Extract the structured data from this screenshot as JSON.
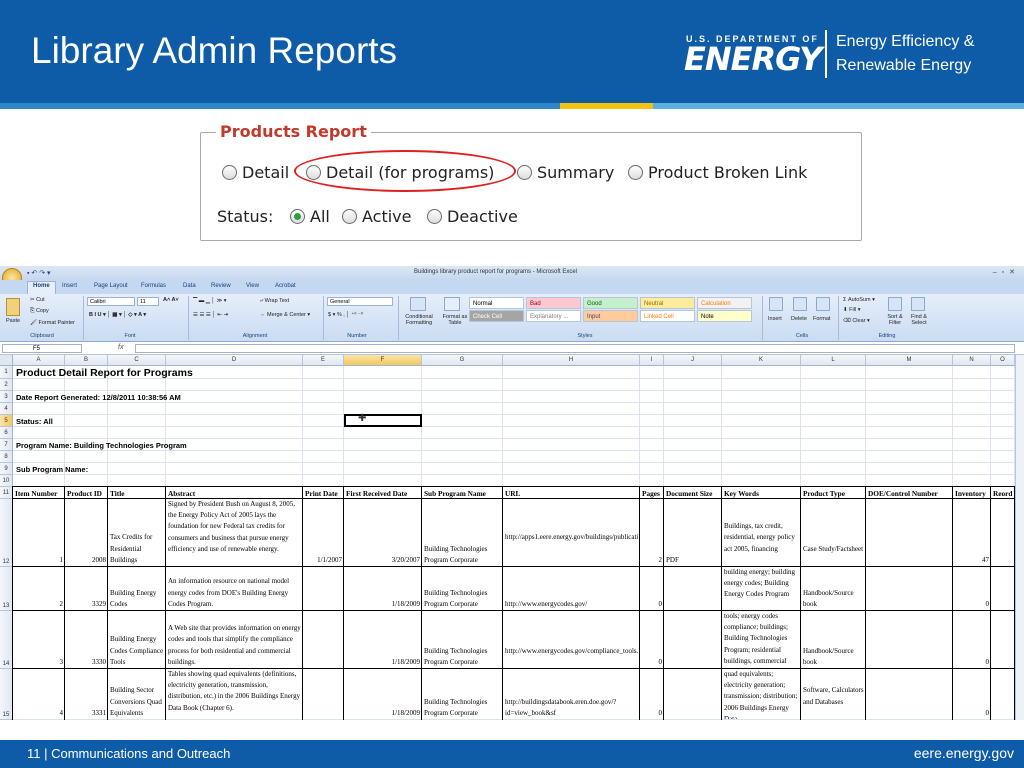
{
  "header": {
    "title": "Library Admin Reports",
    "doe_small": "U.S. DEPARTMENT OF",
    "doe_big": "ENERGY",
    "office_line1": "Energy Efficiency &",
    "office_line2": "Renewable Energy"
  },
  "products_report": {
    "legend": "Products Report",
    "report_options": [
      "Detail",
      "Detail (for programs)",
      "Summary",
      "Product Broken Link"
    ],
    "status_label": "Status:",
    "status_options": [
      "All",
      "Active",
      "Deactive"
    ],
    "selected_status": "All"
  },
  "excel": {
    "window_title": "Buildings library product report for programs - Microsoft Excel",
    "tabs": [
      "Home",
      "Insert",
      "Page Layout",
      "Formulas",
      "Data",
      "Review",
      "View",
      "Acrobat"
    ],
    "ribbon": {
      "clipboard": {
        "paste": "Paste",
        "cut": "Cut",
        "copy": "Copy",
        "format_painter": "Format Painter",
        "label": "Clipboard"
      },
      "font": {
        "name": "Calibri",
        "size": "11",
        "label": "Font"
      },
      "alignment": {
        "wrap_text": "Wrap Text",
        "merge_center": "Merge & Center",
        "label": "Alignment"
      },
      "number": {
        "format": "General",
        "label": "Number"
      },
      "styles": {
        "conditional": "Conditional Formatting",
        "format_table": "Format as Table",
        "cells": [
          {
            "label": "Normal",
            "bg": "#ffffff",
            "fg": "#000000"
          },
          {
            "label": "Bad",
            "bg": "#ffc7ce",
            "fg": "#9c0006"
          },
          {
            "label": "Good",
            "bg": "#c6efce",
            "fg": "#006100"
          },
          {
            "label": "Neutral",
            "bg": "#ffeb9c",
            "fg": "#9c6500"
          },
          {
            "label": "Calculation",
            "bg": "#f2f2f2",
            "fg": "#fa7d00"
          },
          {
            "label": "Check Cell",
            "bg": "#a5a5a5",
            "fg": "#ffffff"
          },
          {
            "label": "Explanatory ...",
            "bg": "#ffffff",
            "fg": "#7f7f7f"
          },
          {
            "label": "Input",
            "bg": "#ffcc99",
            "fg": "#3f3f76"
          },
          {
            "label": "Linked Cell",
            "bg": "#ffffff",
            "fg": "#fa7d00"
          },
          {
            "label": "Note",
            "bg": "#ffffcc",
            "fg": "#000000"
          }
        ],
        "label": "Styles"
      },
      "cells": {
        "insert": "Insert",
        "delete": "Delete",
        "format": "Format",
        "label": "Cells"
      },
      "editing": {
        "autosum": "AutoSum",
        "fill": "Fill",
        "clear": "Clear",
        "sort_filter": "Sort & Filter",
        "find_select": "Find & Select",
        "label": "Editing"
      }
    },
    "name_box": "F5",
    "fx": "fx",
    "columns": [
      "A",
      "B",
      "C",
      "D",
      "E",
      "F",
      "G",
      "H",
      "I",
      "J",
      "K",
      "L",
      "M",
      "N",
      "O"
    ],
    "row_numbers": [
      "1",
      "2",
      "3",
      "4",
      "5",
      "6",
      "7",
      "8",
      "9",
      "10",
      "11",
      "12",
      "13",
      "14",
      "15"
    ],
    "sheet_text": {
      "title": "Product Detail Report for Programs",
      "date": "Date Report Generated: 12/8/2011 10:38:56 AM",
      "status": "Status: All",
      "program": "Program Name: Building Technologies Program",
      "sub_program": "Sub Program Name:"
    },
    "table_headers": [
      "Item Number",
      "Product ID",
      "Title",
      "Abstract",
      "Print Date",
      "First Received Date",
      "Sub Program Name",
      "URL",
      "Pages",
      "Document Size",
      "Key Words",
      "Product Type",
      "DOE/Control Number",
      "Inventory",
      "Reord"
    ],
    "rows": [
      {
        "item": "1",
        "pid": "2008",
        "title": "Tax Credits for Residential Buildings",
        "abstract": "Signed by President Bush on August 8, 2005, the Energy Policy Act of 2005 lays the foundation for new Federal tax credits for consumers and business that pursue energy efficiency and use of renewable energy.",
        "print_date": "1/1/2007",
        "first_received": "3/20/2007",
        "sub_program": "Building Technologies Program Corporate",
        "url": "http://apps1.eere.energy.gov/buildings/publications/pdfs/corporate/residential_taxcredit_07.pdf",
        "pages": "2",
        "doc_size": "PDF",
        "keywords": "Buildings, tax credit, residential, energy policy act 2005, financing",
        "product_type": "Case Study/Factsheet",
        "doe_number": "",
        "inventory": "47"
      },
      {
        "item": "2",
        "pid": "3329",
        "title": "Building Energy Codes",
        "abstract": "An information resource on national model energy codes from DOE's Building Energy Codes Program.",
        "print_date": "",
        "first_received": "1/18/2009",
        "sub_program": "Building Technologies Program Corporate",
        "url": "http://www.energycodes.gov/",
        "pages": "0",
        "doc_size": "",
        "keywords": "building energy; building energy codes; Building Energy Codes Program",
        "product_type": "Handbook/Source book",
        "doe_number": "",
        "inventory": "0"
      },
      {
        "item": "3",
        "pid": "3330",
        "title": "Building Energy Codes Compliance Tools",
        "abstract": "A Web site that provides information on energy codes and tools that simplify the compliance process for both residential and commercial buildings.",
        "print_date": "",
        "first_received": "1/18/2009",
        "sub_program": "Building Technologies Program Corporate",
        "url": "http://www.energycodes.gov/compliance_tools.stm",
        "pages": "0",
        "doc_size": "",
        "keywords": "tools; energy codes compliance; buildings; Building Technologies Program; residential buildings, commercial",
        "product_type": "Handbook/Source book",
        "doe_number": "",
        "inventory": "0"
      },
      {
        "item": "4",
        "pid": "3331",
        "title": "Building Sector Conversions Quad Equivalents",
        "abstract": "Tables showing quad equivalents (definitions, electricity generation, transmission, distribution, etc.) in the 2006 Buildings Energy Data Book (Chapter 6).",
        "print_date": "",
        "first_received": "1/18/2009",
        "sub_program": "Building Technologies Program Corporate",
        "url": "http://buildingsdatabook.eren.doe.gov/?id=view_book&sf",
        "pages": "0",
        "doc_size": "",
        "keywords": "quad equivalents; electricity generation; transmission; distribution; 2006 Buildings Energy Data",
        "product_type": "Software, Calculators and Databases",
        "doe_number": "",
        "inventory": "0"
      }
    ]
  },
  "footer": {
    "left": "11 | Communications and Outreach",
    "right": "eere.energy.gov"
  }
}
